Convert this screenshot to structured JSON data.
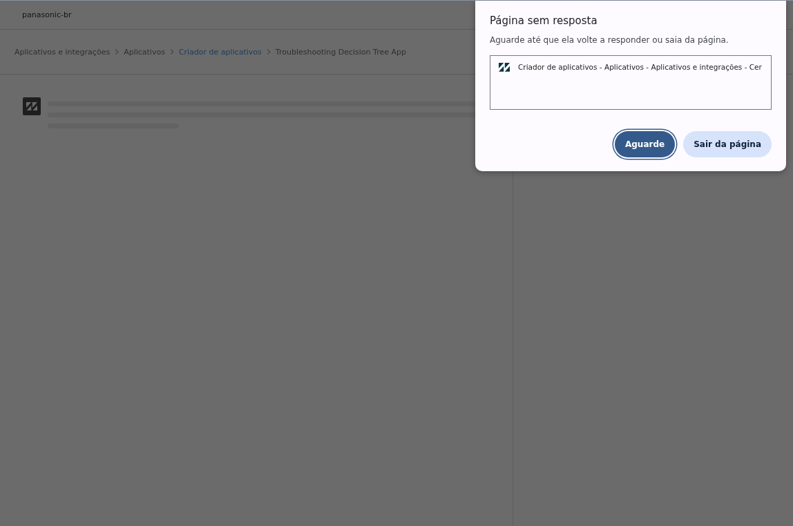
{
  "header": {
    "title": "panasonic-br"
  },
  "breadcrumbs": [
    {
      "label": "Aplicativos e integrações",
      "link": false
    },
    {
      "label": "Aplicativos",
      "link": false
    },
    {
      "label": "Criador de aplicativos",
      "link": true
    },
    {
      "label": "Troubleshooting Decision Tree App",
      "link": false
    }
  ],
  "dialog": {
    "title": "Página sem resposta",
    "message": "Aguarde até que ela volte a responder ou saia da página.",
    "pages": [
      {
        "title": "Criador de aplicativos - Aplicativos - Aplicativos e integrações - Cer"
      }
    ],
    "buttons": [
      {
        "label": "Aguarde",
        "kind": "primary"
      },
      {
        "label": "Sair da página",
        "kind": "secondary"
      }
    ]
  }
}
